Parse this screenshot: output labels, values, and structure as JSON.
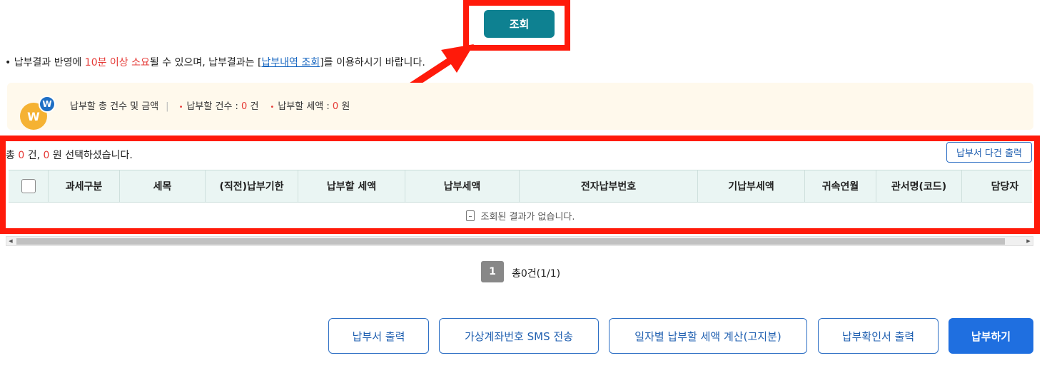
{
  "search": {
    "label": "조회"
  },
  "notice": {
    "part1": "납부결과 반영에 ",
    "highlight": "10분 이상 소요",
    "part2": "될 수 있으며, 납부결과는 [",
    "link": "납부내역 조회",
    "part3": "]를 이용하시기 바랍니다."
  },
  "summary": {
    "logo_big": "W",
    "logo_small": "W",
    "title": "납부할 총 건수 및 금액",
    "count_label": "납부할 건수 : ",
    "count_value": "0",
    "count_unit": " 건",
    "amount_label": "납부할 세액 : ",
    "amount_value": "0",
    "amount_unit": " 원"
  },
  "selection": {
    "prefix": "총 ",
    "count": "0",
    "mid": " 건, ",
    "amount": "0",
    "suffix": " 원 선택하셨습니다."
  },
  "multi_print_label": "납부서 다건 출력",
  "table": {
    "columns": [
      "과세구분",
      "세목",
      "(직전)납부기한",
      "납부할 세액",
      "납부세액",
      "전자납부번호",
      "기납부세액",
      "귀속연월",
      "관서명(코드)",
      "담당자"
    ],
    "empty_message": "조회된 결과가 없습니다."
  },
  "pagination": {
    "current": "1",
    "total": "총0건(1/1)"
  },
  "buttons": {
    "print": "납부서 출력",
    "sms": "가상계좌번호 SMS 전송",
    "daily": "일자별 납부할 세액 계산(고지분)",
    "confirm": "납부확인서 출력",
    "pay": "납부하기"
  },
  "colors": {
    "highlight": "#ff1a0a",
    "search_button": "#0e8191",
    "primary": "#1f6fe0",
    "accent_red": "#e53935"
  }
}
